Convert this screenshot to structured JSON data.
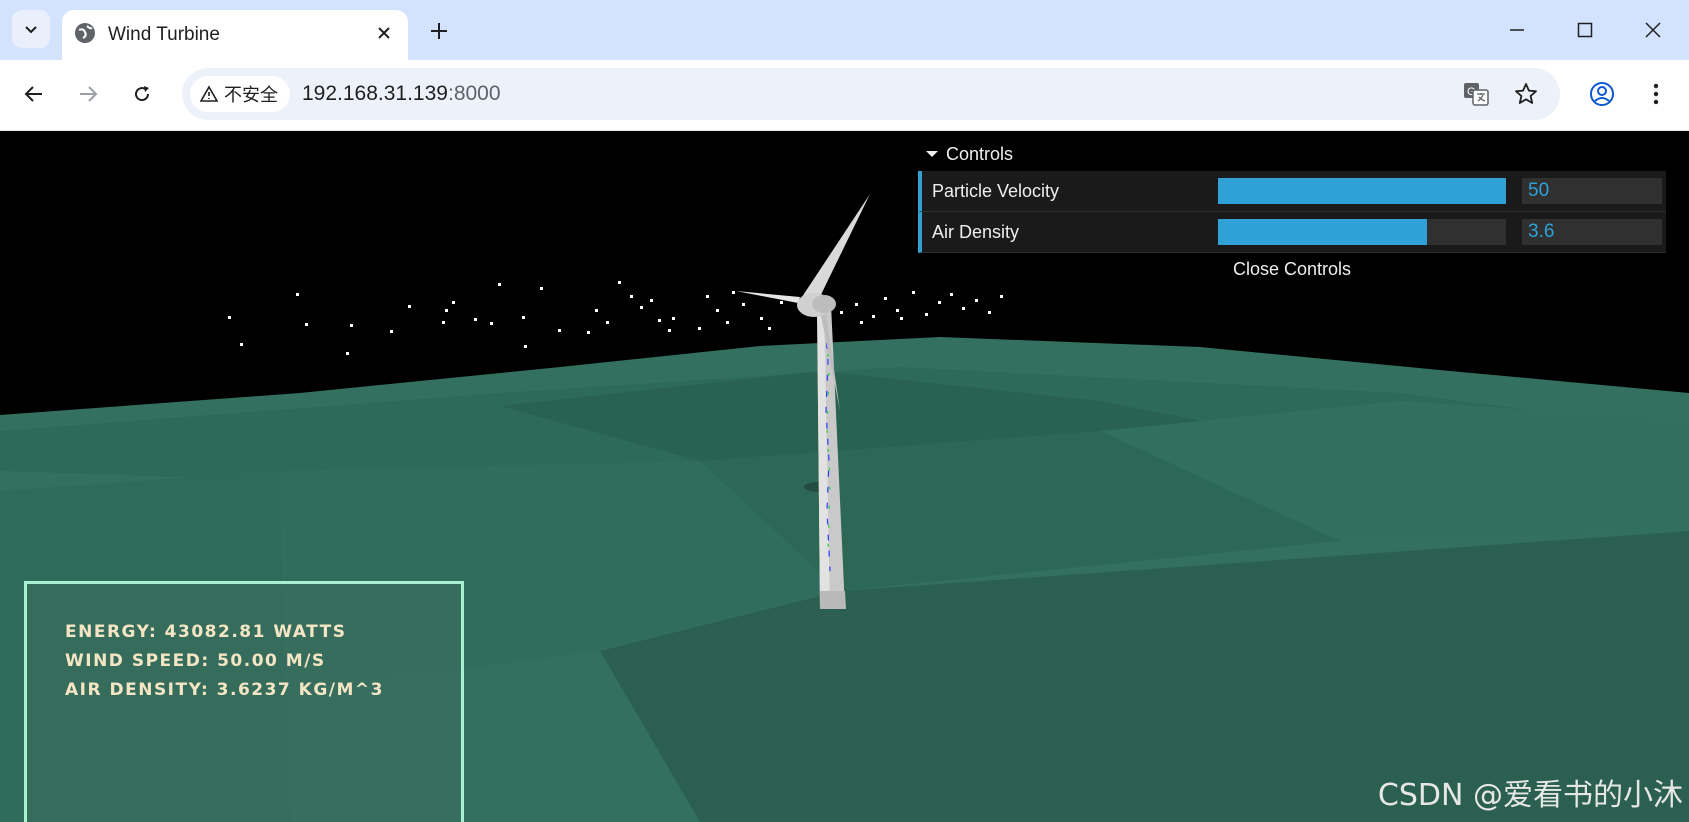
{
  "browser": {
    "tab_title": "Wind Turbine",
    "security_label": "不安全",
    "url_host": "192.168.31.139",
    "url_port": ":8000"
  },
  "gui": {
    "title": "Controls",
    "controls": [
      {
        "label": "Particle Velocity",
        "value": "50",
        "fill_fraction": 1.0
      },
      {
        "label": "Air Density",
        "value": "3.6",
        "fill_fraction": 0.725
      }
    ],
    "close_label": "Close Controls",
    "accent_color": "#2fa1d6"
  },
  "info": {
    "energy": "ENERGY: 43082.81 WATTS",
    "wind_speed": "WIND SPEED: 50.00 M/S",
    "air_density": "AIR DENSITY: 3.6237 KG/M^3"
  },
  "watermark": "CSDN @爱看书的小沐",
  "colors": {
    "terrain": "#2f6a5a",
    "sky": "#000000",
    "panel_border": "#a8f0d0",
    "info_text": "#f4e6c4"
  }
}
